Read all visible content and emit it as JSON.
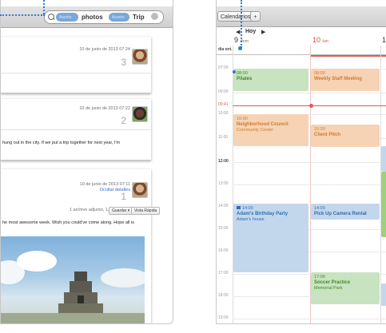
{
  "mail": {
    "search": {
      "token1_label": "Asunto",
      "token1_word": "photos",
      "token2_label": "Asunto",
      "token2_word": "Trip"
    },
    "messages": [
      {
        "date": "10 de junio de 2013 07:24",
        "count": "3",
        "body": ""
      },
      {
        "date": "10 de junio de 2013 07:22",
        "count": "2",
        "body": "hung out in the city. If we put a trip together for next year, I'm"
      },
      {
        "date": "10 de junio de 2013 07:11",
        "count": "1",
        "hide_details": "Ocultar detalles",
        "attachment": "1 archivo adjunto, 1,8 MB",
        "save_label": "Guardar",
        "quicklook_label": "Vista Rápida",
        "body": "he most awesome week. Wish you could've come along. Hope all is"
      }
    ],
    "colors": {
      "accent": "#2a6ecf",
      "token": "#7aa8d8"
    }
  },
  "calendar": {
    "toolbar": {
      "calendars_label": "Calendarios",
      "add_label": "+"
    },
    "nav": {
      "prev": "◀",
      "today": "Hoy",
      "next": "▶"
    },
    "days": [
      {
        "num": "9",
        "name": "dom"
      },
      {
        "num": "10",
        "name": "lun"
      },
      {
        "num": "1",
        "name": ""
      }
    ],
    "allday_label": "día ent.",
    "hours": [
      "07:00",
      "08:00",
      "09:00",
      "10:00",
      "11:00",
      "12:00",
      "13:00",
      "14:00",
      "15:00",
      "16:00",
      "17:00",
      "18:00",
      "19:00"
    ],
    "now_label": "09:41",
    "events": [
      {
        "key": "pilates",
        "time": "08:00",
        "name": "Pilates",
        "loc": ""
      },
      {
        "key": "staff",
        "time": "08:00",
        "name": "Weekly Staff Meeting",
        "loc": ""
      },
      {
        "key": "council",
        "time": "10:00",
        "name": "Neighborhood Council",
        "loc": "Community Center"
      },
      {
        "key": "pitch",
        "time": "10:30",
        "name": "Client Pitch",
        "loc": ""
      },
      {
        "key": "bday",
        "time": "14:00",
        "name": "Adam's Birthday Party",
        "loc": "Adam's house"
      },
      {
        "key": "camera",
        "time": "14:00",
        "name": "Pick Up Camera Rental",
        "loc": ""
      },
      {
        "key": "soccer",
        "time": "17:00",
        "name": "Soccer Practice",
        "loc": "Memorial Park"
      }
    ],
    "colors": {
      "now_line": "#e05a50",
      "green": "#c8e3bf",
      "orange": "#f6d3b4",
      "blue": "#c3d7ec"
    }
  }
}
